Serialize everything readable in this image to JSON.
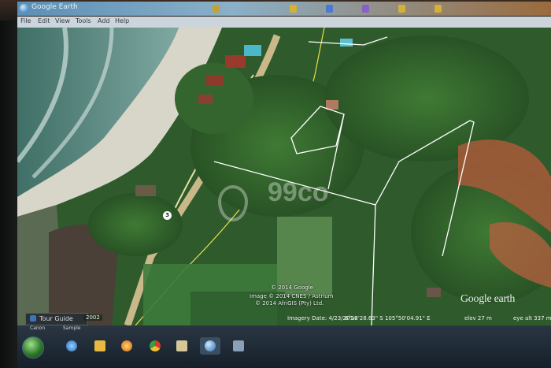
{
  "window": {
    "title": "Google Earth"
  },
  "menubar": {
    "items": [
      "File",
      "Edit",
      "View",
      "Tools",
      "Add",
      "Help"
    ]
  },
  "map": {
    "watermark": "99co",
    "route_number": "3",
    "copyright_lines": [
      "© 2014 Google",
      "Image © 2014 CNES / Astrium",
      "© 2014 AfriGIS (Pty) Ltd."
    ],
    "logo": "Google earth"
  },
  "status": {
    "tour_guide_label": "Tour Guide",
    "year": "2002",
    "imagery_date": "Imagery Date: 4/23/2014",
    "coordinates": "6°13'28.63\" S  105°50'04.91\" E",
    "elevation": "elev  27 m",
    "eye_alt": "eye alt  337 m"
  },
  "taskbar": {
    "desktop_icons": [
      "Canon",
      "Sample",
      "",
      "",
      "",
      "",
      "",
      "",
      "",
      ""
    ],
    "apps": [
      "ie-icon",
      "explorer-icon",
      "media-icon",
      "chrome-icon",
      "folder-icon",
      "earth-icon",
      "network-icon"
    ]
  },
  "colors": {
    "titlebar": "#5b8fb5",
    "menubar": "#cdd5dc",
    "taskbar": "#1e2a34",
    "boundary": "#ffffff",
    "road_line": "#e8e04a"
  }
}
